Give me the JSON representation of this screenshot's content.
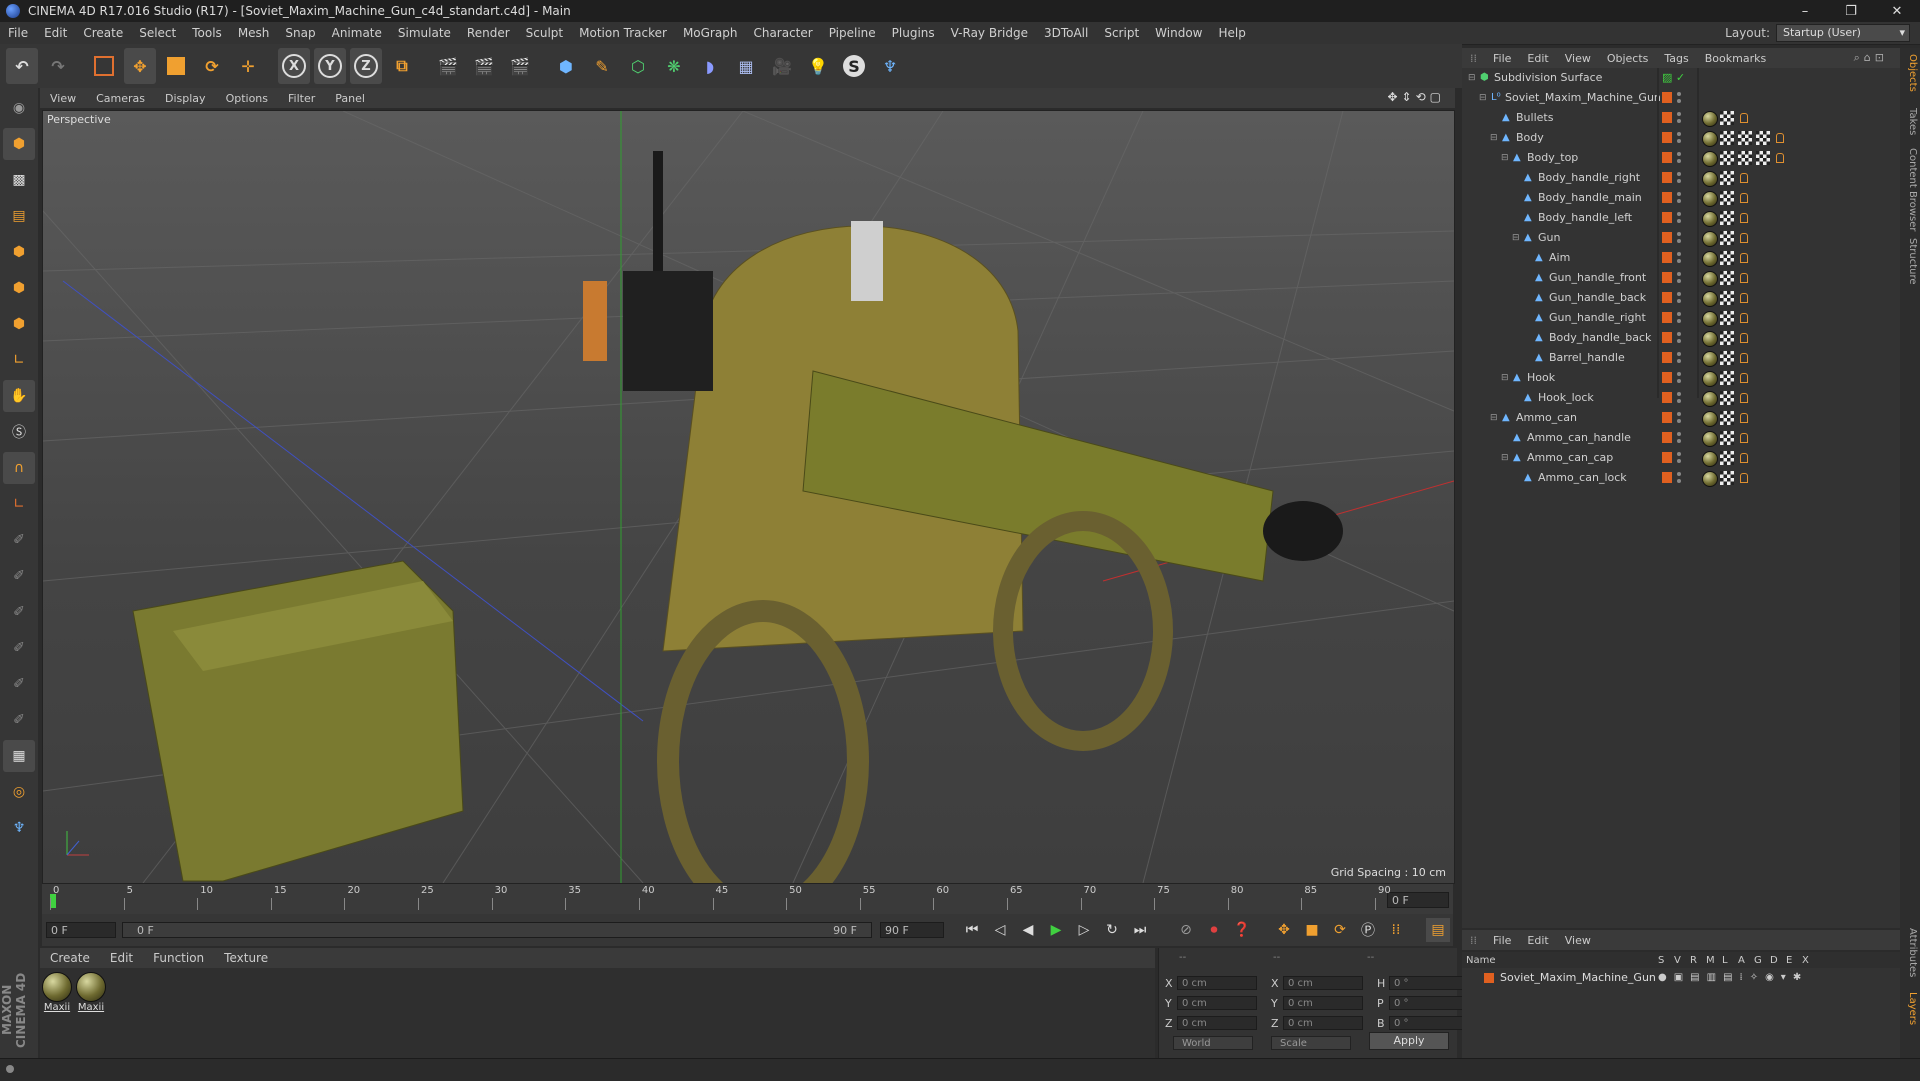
{
  "titlebar": {
    "title": "CINEMA 4D R17.016 Studio (R17) - [Soviet_Maxim_Machine_Gun_c4d_standart.c4d] - Main",
    "minimize": "–",
    "restore": "❐",
    "close": "✕"
  },
  "menu": [
    "File",
    "Edit",
    "Create",
    "Select",
    "Tools",
    "Mesh",
    "Snap",
    "Animate",
    "Simulate",
    "Render",
    "Sculpt",
    "Motion Tracker",
    "MoGraph",
    "Character",
    "Pipeline",
    "Plugins",
    "V-Ray Bridge",
    "3DToAll",
    "Script",
    "Window",
    "Help"
  ],
  "layout": {
    "label": "Layout:",
    "value": "Startup (User)"
  },
  "viewport": {
    "menu": [
      "View",
      "Cameras",
      "Display",
      "Options",
      "Filter",
      "Panel"
    ],
    "label": "Perspective",
    "grid_spacing": "Grid Spacing : 10 cm"
  },
  "timeline": {
    "ticks": [
      "0",
      "5",
      "10",
      "15",
      "20",
      "25",
      "30",
      "35",
      "40",
      "45",
      "50",
      "55",
      "60",
      "65",
      "70",
      "75",
      "80",
      "85",
      "90"
    ],
    "current_frame": "0 F",
    "start_field": "0 F",
    "range_start": "0 F",
    "range_end": "90 F",
    "end_field": "90 F",
    "range_end_right": "0 F"
  },
  "materials": {
    "menu": [
      "Create",
      "Edit",
      "Function",
      "Texture"
    ],
    "items": [
      {
        "label": "Maxii"
      },
      {
        "label": "Maxii"
      }
    ]
  },
  "coords": {
    "header1": "--",
    "header2": "--",
    "header3": "--",
    "rows": [
      {
        "l1": "X",
        "v1": "0 cm",
        "l2": "X",
        "v2": "0 cm",
        "l3": "H",
        "v3": "0 °"
      },
      {
        "l1": "Y",
        "v1": "0 cm",
        "l2": "Y",
        "v2": "0 cm",
        "l3": "P",
        "v3": "0 °"
      },
      {
        "l1": "Z",
        "v1": "0 cm",
        "l2": "Z",
        "v2": "0 cm",
        "l3": "B",
        "v3": "0 °"
      }
    ],
    "mode1": "World",
    "mode2": "Scale",
    "apply": "Apply"
  },
  "objects": {
    "menu": [
      "File",
      "Edit",
      "View",
      "Objects",
      "Tags",
      "Bookmarks"
    ],
    "tree": [
      {
        "name": "Subdivision Surface",
        "depth": 0,
        "tags": 0
      },
      {
        "name": "Soviet_Maxim_Machine_Gun",
        "depth": 1,
        "tags": 0
      },
      {
        "name": "Bullets",
        "depth": 2,
        "tags": 3
      },
      {
        "name": "Body",
        "depth": 2,
        "tags": 5
      },
      {
        "name": "Body_top",
        "depth": 3,
        "tags": 5
      },
      {
        "name": "Body_handle_right",
        "depth": 4,
        "tags": 3
      },
      {
        "name": "Body_handle_main",
        "depth": 4,
        "tags": 3
      },
      {
        "name": "Body_handle_left",
        "depth": 4,
        "tags": 3
      },
      {
        "name": "Gun",
        "depth": 4,
        "tags": 3
      },
      {
        "name": "Aim",
        "depth": 5,
        "tags": 3
      },
      {
        "name": "Gun_handle_front",
        "depth": 5,
        "tags": 3
      },
      {
        "name": "Gun_handle_back",
        "depth": 5,
        "tags": 3
      },
      {
        "name": "Gun_handle_right",
        "depth": 5,
        "tags": 3
      },
      {
        "name": "Body_handle_back",
        "depth": 5,
        "tags": 3
      },
      {
        "name": "Barrel_handle",
        "depth": 5,
        "tags": 3
      },
      {
        "name": "Hook",
        "depth": 3,
        "tags": 3
      },
      {
        "name": "Hook_lock",
        "depth": 4,
        "tags": 3
      },
      {
        "name": "Ammo_can",
        "depth": 2,
        "tags": 3
      },
      {
        "name": "Ammo_can_handle",
        "depth": 3,
        "tags": 3
      },
      {
        "name": "Ammo_can_cap",
        "depth": 3,
        "tags": 3
      },
      {
        "name": "Ammo_can_lock",
        "depth": 4,
        "tags": 3
      }
    ]
  },
  "right_tabs": [
    "Objects",
    "Takes",
    "Content Browser",
    "Structure",
    "Attributes",
    "Layers"
  ],
  "layers": {
    "menu": [
      "File",
      "Edit",
      "View"
    ],
    "headers": [
      "Name",
      "S",
      "V",
      "R",
      "M",
      "L",
      "A",
      "G",
      "D",
      "E",
      "X"
    ],
    "row": "Soviet_Maxim_Machine_Gun"
  },
  "logo": "MAXON CINEMA 4D",
  "colors": {
    "accent": "#e06020",
    "selection": "#4a7fbf",
    "play": "#40d040"
  }
}
